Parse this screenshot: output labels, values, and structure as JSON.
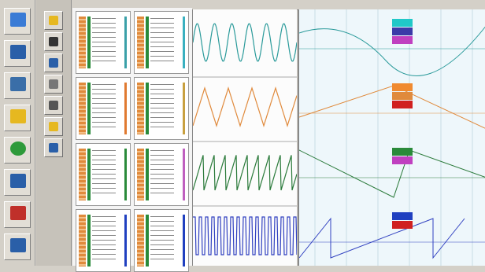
{
  "toolbar_left": {
    "buttons": [
      {
        "icon": "chart-icon",
        "label": "",
        "color": "#3a7bd5"
      },
      {
        "icon": "network-icon",
        "label": "",
        "color": "#2a5fa8"
      },
      {
        "icon": "monitor-icon",
        "label": "",
        "color": "#3a6ea8"
      },
      {
        "icon": "folder-star-icon",
        "label": "",
        "color": "#e6b820"
      },
      {
        "icon": "help-icon",
        "label": "",
        "color": "#2e9a3a"
      },
      {
        "icon": "print-icon",
        "label": "",
        "color": "#2a5fa8"
      },
      {
        "icon": "tool-icon",
        "label": "",
        "color": "#c0302a"
      },
      {
        "icon": "save-icon",
        "label": "",
        "color": "#2a5fa8"
      }
    ]
  },
  "toolbar_right": {
    "buttons": [
      {
        "icon": "pencil-icon",
        "color": "#e6b820"
      },
      {
        "icon": "window-icon",
        "color": "#333"
      },
      {
        "icon": "grid-icon",
        "color": "#2a5fa8"
      },
      {
        "icon": "settings-icon",
        "color": "#777"
      },
      {
        "icon": "display-icon",
        "color": "#555"
      },
      {
        "icon": "folder-icon",
        "color": "#e6b820"
      },
      {
        "icon": "refresh-icon",
        "color": "#2a5fa8"
      }
    ]
  },
  "panels": [
    {
      "accent": "#3aa0a8"
    },
    {
      "accent": "#3ab0c0"
    },
    {
      "accent": "#e07a30"
    },
    {
      "accent": "#c8a040"
    },
    {
      "accent": "#2a8a3a"
    },
    {
      "accent": "#c060c0"
    },
    {
      "accent": "#2040c0"
    },
    {
      "accent": "#2040c0"
    }
  ],
  "waves": [
    {
      "color": "#2a9a9a",
      "kind": "sine"
    },
    {
      "color": "#e08a3c",
      "kind": "triangle"
    },
    {
      "color": "#2a7a3a",
      "kind": "saw"
    },
    {
      "color": "#3040c0",
      "kind": "square"
    }
  ],
  "trend_tags": [
    {
      "colors": [
        "#20c8c8",
        "#3a3aa8",
        "#c040c0"
      ]
    },
    {
      "colors": [
        "#f08a30",
        "#e08a3c",
        "#d02020"
      ]
    },
    {
      "colors": [
        "#2a8a3a",
        "#c040c0"
      ]
    },
    {
      "colors": [
        "#2040c0",
        "#d02020"
      ]
    }
  ]
}
